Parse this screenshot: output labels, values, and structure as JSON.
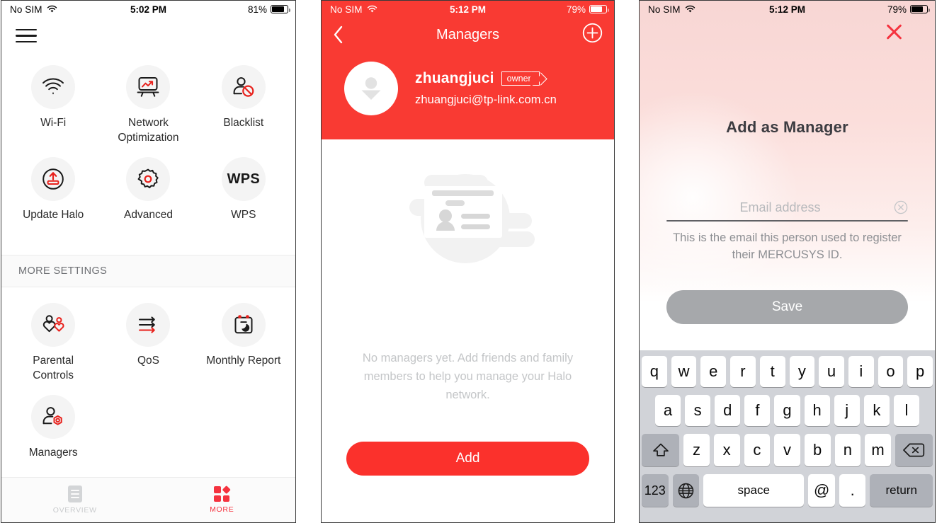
{
  "phone1": {
    "status": {
      "carrier": "No SIM",
      "wifi_icon": "wifi-icon",
      "time": "5:02 PM",
      "battery_pct": "81%"
    },
    "menu_icon": "hamburger-menu-icon",
    "tiles": [
      {
        "label": "Wi-Fi",
        "icon": "wifi-icon"
      },
      {
        "label": "Network Optimization",
        "icon": "network-optimization-icon"
      },
      {
        "label": "Blacklist",
        "icon": "blacklist-icon"
      },
      {
        "label": "Update Halo",
        "icon": "update-halo-icon"
      },
      {
        "label": "Advanced",
        "icon": "gear-icon"
      },
      {
        "label": "WPS",
        "icon": "wps-icon"
      }
    ],
    "section_title": "MORE SETTINGS",
    "more_tiles": [
      {
        "label": "Parental Controls",
        "icon": "parental-controls-icon"
      },
      {
        "label": "QoS",
        "icon": "qos-icon"
      },
      {
        "label": "Monthly Report",
        "icon": "monthly-report-icon"
      },
      {
        "label": "Managers",
        "icon": "managers-icon"
      }
    ],
    "tabbar": {
      "overview": {
        "label": "OVERVIEW",
        "icon": "overview-icon",
        "active": false
      },
      "more": {
        "label": "MORE",
        "icon": "more-grid-icon",
        "active": true
      }
    }
  },
  "phone2": {
    "status": {
      "carrier": "No SIM",
      "wifi_icon": "wifi-icon",
      "time": "5:12 PM",
      "battery_pct": "79%"
    },
    "nav": {
      "back_icon": "chevron-left-icon",
      "title": "Managers",
      "add_icon": "plus-circle-icon"
    },
    "owner": {
      "avatar_icon": "person-avatar-icon",
      "name": "zhuangjuci",
      "badge": "owner",
      "email": "zhuangjuci@tp-link.com.cn"
    },
    "empty": {
      "illustration": "id-card-illustration",
      "text": "No managers yet. Add friends and family members to help you manage your Halo network."
    },
    "add_button": "Add"
  },
  "phone3": {
    "status": {
      "carrier": "No SIM",
      "wifi_icon": "wifi-icon",
      "time": "5:12 PM",
      "battery_pct": "79%"
    },
    "close_icon": "close-x-icon",
    "title": "Add as Manager",
    "email_field": {
      "value": "",
      "placeholder": "Email address",
      "clear_icon": "clear-circle-icon"
    },
    "hint": "This is the email this person used to register their MERCUSYS ID.",
    "save_button": "Save",
    "keyboard": {
      "row1": [
        "q",
        "w",
        "e",
        "r",
        "t",
        "y",
        "u",
        "i",
        "o",
        "p"
      ],
      "row2": [
        "a",
        "s",
        "d",
        "f",
        "g",
        "h",
        "j",
        "k",
        "l"
      ],
      "row3_letters": [
        "z",
        "x",
        "c",
        "v",
        "b",
        "n",
        "m"
      ],
      "shift_icon": "shift-arrow-icon",
      "backspace_icon": "backspace-icon",
      "numeric_key": "123",
      "globe_icon": "globe-icon",
      "space_key": "space",
      "at_key": "@",
      "dot_key": ".",
      "return_key": "return"
    }
  },
  "colors": {
    "brand_red": "#f93a33",
    "tab_red": "#f5333f",
    "button_red": "#fb312c",
    "disabled_gray": "#a6a8ab"
  }
}
